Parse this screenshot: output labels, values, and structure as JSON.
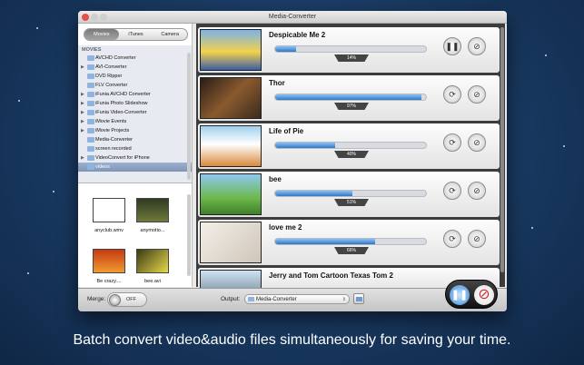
{
  "window": {
    "title": "Media-Converter"
  },
  "tabs": [
    "Movies",
    "iTunes",
    "Camera"
  ],
  "sources": {
    "section": "MOVIES",
    "items": [
      {
        "label": "AVCHD Converter",
        "expandable": false
      },
      {
        "label": "AVI-Converter",
        "expandable": true
      },
      {
        "label": "DVD Ripper",
        "expandable": false
      },
      {
        "label": "FLV Converter",
        "expandable": false
      },
      {
        "label": "iFunia AVCHD Converter",
        "expandable": true
      },
      {
        "label": "iFunia Photo Slideshow",
        "expandable": true
      },
      {
        "label": "iFunia Video-Converter",
        "expandable": true
      },
      {
        "label": "iMovie Events",
        "expandable": true
      },
      {
        "label": "iMovie Projects",
        "expandable": true
      },
      {
        "label": "Media-Converter",
        "expandable": false
      },
      {
        "label": "screen recorded",
        "expandable": false
      },
      {
        "label": "VideoConvert for iPhone",
        "expandable": true
      },
      {
        "label": "videos",
        "expandable": false,
        "selected": true
      }
    ]
  },
  "thumbnails": [
    "anyclub.wmv",
    "anymotio...",
    "Be crazy....",
    "bee.avi"
  ],
  "conversions": [
    {
      "title": "Despicable Me 2",
      "progress": 14,
      "progress_label": "14%",
      "state": "pause"
    },
    {
      "title": "Thor",
      "progress": 97,
      "progress_label": "97%",
      "state": "retry"
    },
    {
      "title": "Life of Pie",
      "progress": 40,
      "progress_label": "40%",
      "state": "retry"
    },
    {
      "title": "bee",
      "progress": 51,
      "progress_label": "51%",
      "state": "retry"
    },
    {
      "title": "love me 2",
      "progress": 66,
      "progress_label": "66%",
      "state": "retry"
    },
    {
      "title": "Jerry and Tom Cartoon Texas Tom 2",
      "progress": null,
      "progress_label": "",
      "state": "partial"
    }
  ],
  "bottom": {
    "merge_label": "Merge:",
    "merge_state": "OFF",
    "output_label": "Output:",
    "output_value": "Media-Converter"
  },
  "caption": "Batch convert video&audio files simultaneously for saving your time."
}
